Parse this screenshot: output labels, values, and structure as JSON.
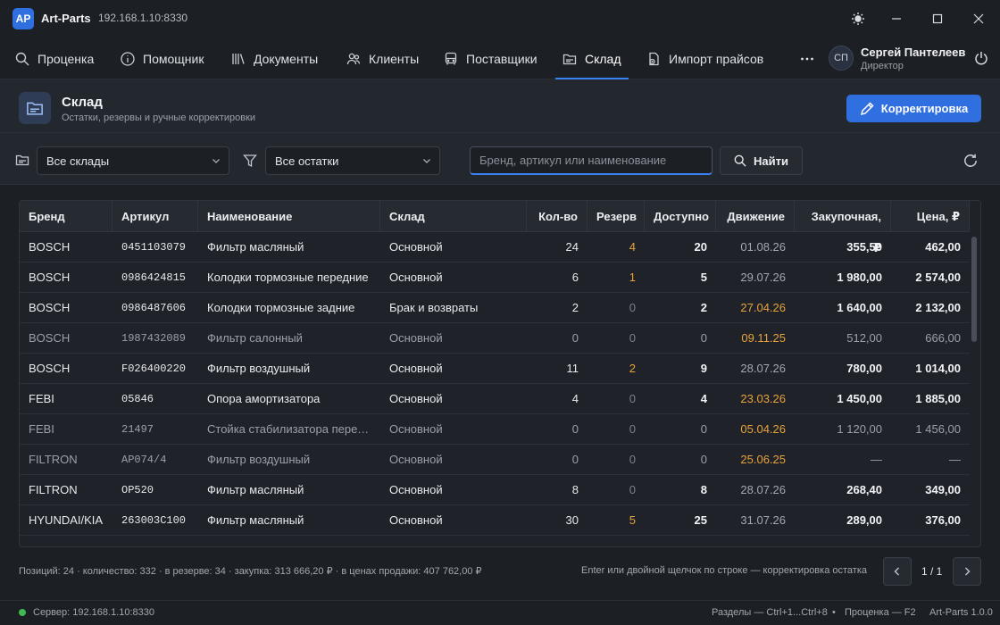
{
  "app": {
    "logo": "AP",
    "name": "Art-Parts",
    "address": "192.168.1.10:8330"
  },
  "nav": [
    {
      "label": "Проценка",
      "icon": "search-icon"
    },
    {
      "label": "Помощник",
      "icon": "info-icon"
    },
    {
      "label": "Документы",
      "icon": "library-icon"
    },
    {
      "label": "Клиенты",
      "icon": "users-icon"
    },
    {
      "label": "Поставщики",
      "icon": "truck-icon"
    },
    {
      "label": "Склад",
      "icon": "folder-icon",
      "active": true
    },
    {
      "label": "Импорт прайсов",
      "icon": "file-import-icon"
    }
  ],
  "user": {
    "initials": "СП",
    "name": "Сергей Пантелеев",
    "role": "Директор"
  },
  "page": {
    "title": "Склад",
    "subtitle": "Остатки, резервы и ручные корректировки",
    "primary_action": "Корректировка"
  },
  "filters": {
    "warehouse": "Все склады",
    "stock": "Все остатки",
    "search_placeholder": "Бренд, артикул или наименование",
    "find_label": "Найти"
  },
  "table": {
    "columns": [
      "Бренд",
      "Артикул",
      "Наименование",
      "Склад",
      "Кол-во",
      "Резерв",
      "Доступно",
      "Движение",
      "Закупочная, ₽",
      "Цена, ₽"
    ],
    "rows": [
      {
        "brand": "BOSCH",
        "article": "0451103079",
        "name": "Фильтр масляный",
        "warehouse": "Основной",
        "qty": "24",
        "reserve": "4",
        "available": "20",
        "movement": "01.08.26",
        "purchase": "355,50",
        "price": "462,00"
      },
      {
        "brand": "BOSCH",
        "article": "0986424815",
        "name": "Колодки тормозные передние",
        "warehouse": "Основной",
        "qty": "6",
        "reserve": "1",
        "available": "5",
        "movement": "29.07.26",
        "purchase": "1 980,00",
        "price": "2 574,00"
      },
      {
        "brand": "BOSCH",
        "article": "0986487606",
        "name": "Колодки тормозные задние",
        "warehouse": "Брак и возвраты",
        "qty": "2",
        "reserve": "0",
        "available": "2",
        "movement": "27.04.26",
        "purchase": "1 640,00",
        "price": "2 132,00"
      },
      {
        "brand": "BOSCH",
        "article": "1987432089",
        "name": "Фильтр салонный",
        "warehouse": "Основной",
        "qty": "0",
        "reserve": "0",
        "available": "0",
        "movement": "09.11.25",
        "purchase": "512,00",
        "price": "666,00"
      },
      {
        "brand": "BOSCH",
        "article": "F026400220",
        "name": "Фильтр воздушный",
        "warehouse": "Основной",
        "qty": "11",
        "reserve": "2",
        "available": "9",
        "movement": "28.07.26",
        "purchase": "780,00",
        "price": "1 014,00"
      },
      {
        "brand": "FEBI",
        "article": "05846",
        "name": "Опора амортизатора",
        "warehouse": "Основной",
        "qty": "4",
        "reserve": "0",
        "available": "4",
        "movement": "23.03.26",
        "purchase": "1 450,00",
        "price": "1 885,00"
      },
      {
        "brand": "FEBI",
        "article": "21497",
        "name": "Стойка стабилизатора передняя",
        "warehouse": "Основной",
        "qty": "0",
        "reserve": "0",
        "available": "0",
        "movement": "05.04.26",
        "purchase": "1 120,00",
        "price": "1 456,00"
      },
      {
        "brand": "FILTRON",
        "article": "AP074/4",
        "name": "Фильтр воздушный",
        "warehouse": "Основной",
        "qty": "0",
        "reserve": "0",
        "available": "0",
        "movement": "25.06.25",
        "purchase": "—",
        "price": "—"
      },
      {
        "brand": "FILTRON",
        "article": "OP520",
        "name": "Фильтр масляный",
        "warehouse": "Основной",
        "qty": "8",
        "reserve": "0",
        "available": "8",
        "movement": "28.07.26",
        "purchase": "268,40",
        "price": "349,00"
      },
      {
        "brand": "HYUNDAI/KIA",
        "article": "263003C100",
        "name": "Фильтр масляный",
        "warehouse": "Основной",
        "qty": "30",
        "reserve": "5",
        "available": "25",
        "movement": "31.07.26",
        "purchase": "289,00",
        "price": "376,00"
      }
    ]
  },
  "footer": {
    "summary": "Позиций: 24 · количество: 332 · в резерве: 34 · закупка: 313 666,20 ₽ · в ценах продажи: 407 762,00 ₽",
    "hint": "Enter или двойной щелчок по строке — корректировка остатка",
    "pager": "1 / 1"
  },
  "status": {
    "server": "Сервер: 192.168.1.10:8330",
    "shortcut_sections": "Разделы — Ctrl+1...Ctrl+8",
    "shortcut_pricing": "Проценка — F2",
    "version": "Art-Parts 1.0.0"
  },
  "colors": {
    "accent": "#2f6fe0",
    "warning": "#e8a23a",
    "online": "#3fb950"
  }
}
